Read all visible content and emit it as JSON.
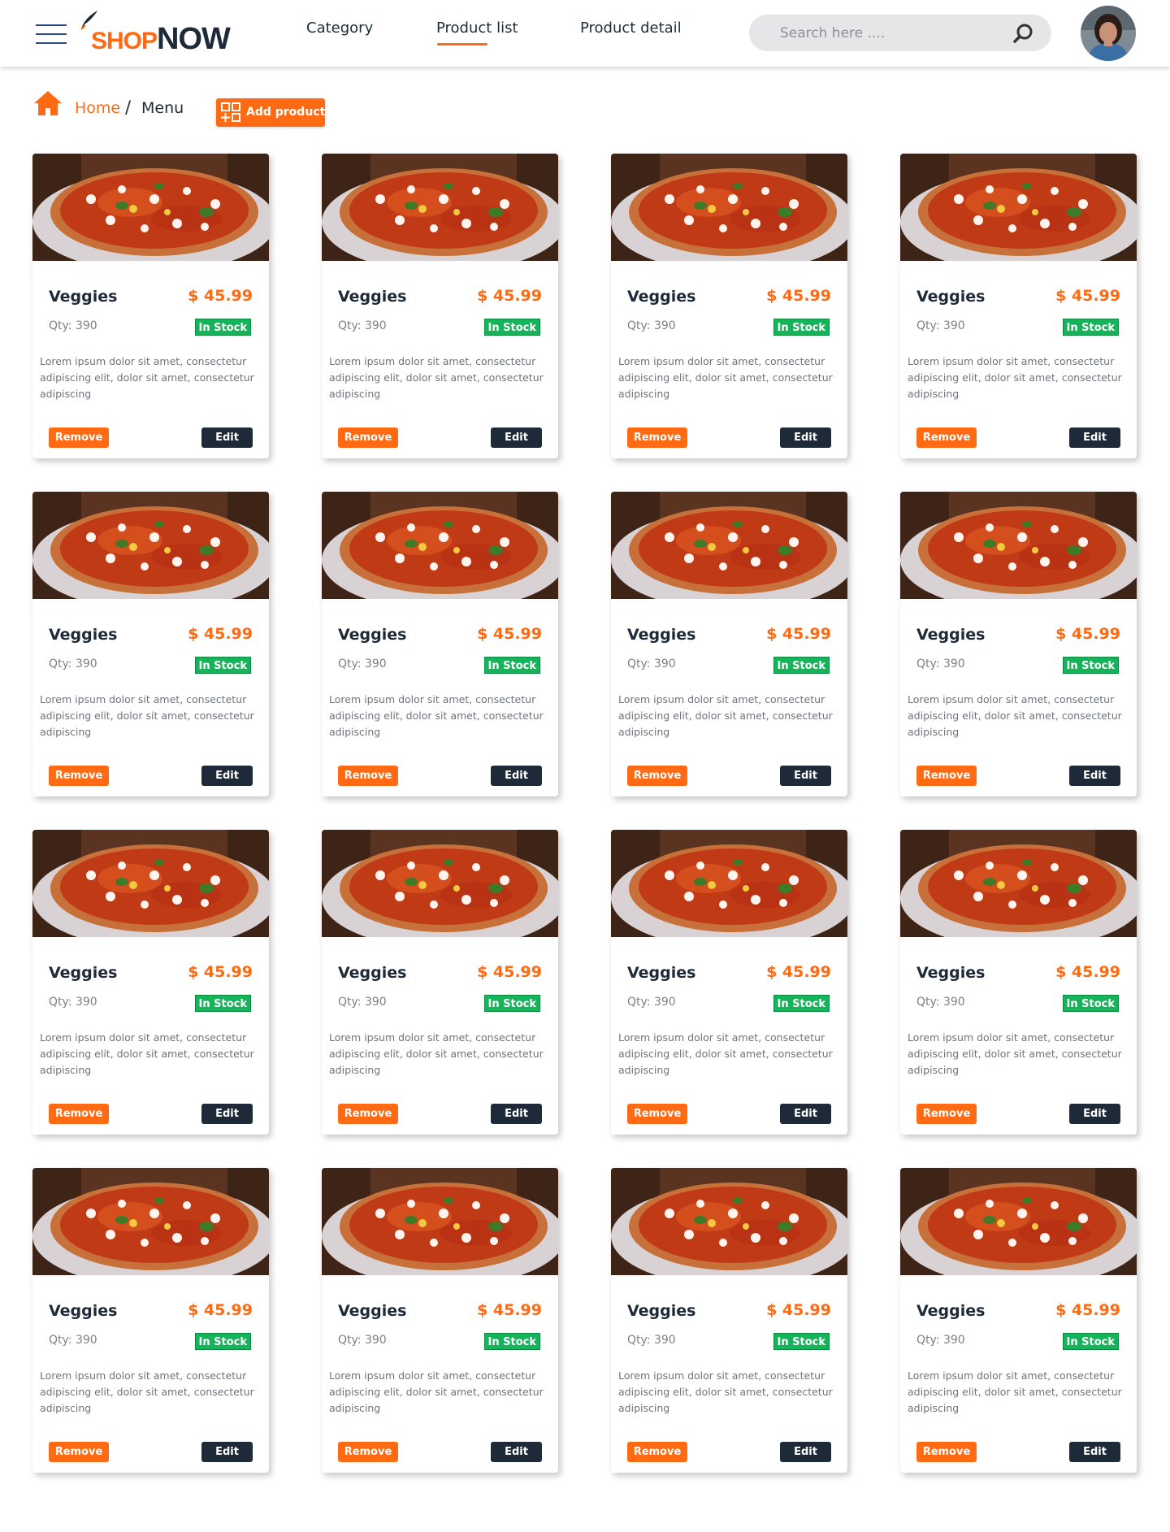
{
  "header": {
    "logo": {
      "shop": "SHOP",
      "now": "NOW"
    },
    "nav": [
      {
        "label": "Category",
        "active": false
      },
      {
        "label": "Product list",
        "active": true
      },
      {
        "label": "Product detail",
        "active": false
      }
    ],
    "search": {
      "placeholder": "Search here ...."
    }
  },
  "breadcrumb": {
    "home": "Home",
    "separator": "/",
    "current": "Menu"
  },
  "add_product_label": "Add product",
  "products": [
    {
      "name": "Veggies",
      "price": "$ 45.99",
      "qty": "Qty: 390",
      "stock": "In Stock",
      "description": "Lorem ipsum dolor sit amet, consectetur adipiscing elit, dolor sit amet, consectetur adipiscing",
      "remove": "Remove",
      "edit": "Edit"
    },
    {
      "name": "Veggies",
      "price": "$ 45.99",
      "qty": "Qty: 390",
      "stock": "In Stock",
      "description": "Lorem ipsum dolor sit amet, consectetur adipiscing elit, dolor sit amet, consectetur adipiscing",
      "remove": "Remove",
      "edit": "Edit"
    },
    {
      "name": "Veggies",
      "price": "$ 45.99",
      "qty": "Qty: 390",
      "stock": "In Stock",
      "description": "Lorem ipsum dolor sit amet, consectetur adipiscing elit, dolor sit amet, consectetur adipiscing",
      "remove": "Remove",
      "edit": "Edit"
    },
    {
      "name": "Veggies",
      "price": "$ 45.99",
      "qty": "Qty: 390",
      "stock": "In Stock",
      "description": "Lorem ipsum dolor sit amet, consectetur adipiscing elit, dolor sit amet, consectetur adipiscing",
      "remove": "Remove",
      "edit": "Edit"
    },
    {
      "name": "Veggies",
      "price": "$ 45.99",
      "qty": "Qty: 390",
      "stock": "In Stock",
      "description": "Lorem ipsum dolor sit amet, consectetur adipiscing elit, dolor sit amet, consectetur adipiscing",
      "remove": "Remove",
      "edit": "Edit"
    },
    {
      "name": "Veggies",
      "price": "$ 45.99",
      "qty": "Qty: 390",
      "stock": "In Stock",
      "description": "Lorem ipsum dolor sit amet, consectetur adipiscing elit, dolor sit amet, consectetur adipiscing",
      "remove": "Remove",
      "edit": "Edit"
    },
    {
      "name": "Veggies",
      "price": "$ 45.99",
      "qty": "Qty: 390",
      "stock": "In Stock",
      "description": "Lorem ipsum dolor sit amet, consectetur adipiscing elit, dolor sit amet, consectetur adipiscing",
      "remove": "Remove",
      "edit": "Edit"
    },
    {
      "name": "Veggies",
      "price": "$ 45.99",
      "qty": "Qty: 390",
      "stock": "In Stock",
      "description": "Lorem ipsum dolor sit amet, consectetur adipiscing elit, dolor sit amet, consectetur adipiscing",
      "remove": "Remove",
      "edit": "Edit"
    },
    {
      "name": "Veggies",
      "price": "$ 45.99",
      "qty": "Qty: 390",
      "stock": "In Stock",
      "description": "Lorem ipsum dolor sit amet, consectetur adipiscing elit, dolor sit amet, consectetur adipiscing",
      "remove": "Remove",
      "edit": "Edit"
    },
    {
      "name": "Veggies",
      "price": "$ 45.99",
      "qty": "Qty: 390",
      "stock": "In Stock",
      "description": "Lorem ipsum dolor sit amet, consectetur adipiscing elit, dolor sit amet, consectetur adipiscing",
      "remove": "Remove",
      "edit": "Edit"
    },
    {
      "name": "Veggies",
      "price": "$ 45.99",
      "qty": "Qty: 390",
      "stock": "In Stock",
      "description": "Lorem ipsum dolor sit amet, consectetur adipiscing elit, dolor sit amet, consectetur adipiscing",
      "remove": "Remove",
      "edit": "Edit"
    },
    {
      "name": "Veggies",
      "price": "$ 45.99",
      "qty": "Qty: 390",
      "stock": "In Stock",
      "description": "Lorem ipsum dolor sit amet, consectetur adipiscing elit, dolor sit amet, consectetur adipiscing",
      "remove": "Remove",
      "edit": "Edit"
    },
    {
      "name": "Veggies",
      "price": "$ 45.99",
      "qty": "Qty: 390",
      "stock": "In Stock",
      "description": "Lorem ipsum dolor sit amet, consectetur adipiscing elit, dolor sit amet, consectetur adipiscing",
      "remove": "Remove",
      "edit": "Edit"
    },
    {
      "name": "Veggies",
      "price": "$ 45.99",
      "qty": "Qty: 390",
      "stock": "In Stock",
      "description": "Lorem ipsum dolor sit amet, consectetur adipiscing elit, dolor sit amet, consectetur adipiscing",
      "remove": "Remove",
      "edit": "Edit"
    },
    {
      "name": "Veggies",
      "price": "$ 45.99",
      "qty": "Qty: 390",
      "stock": "In Stock",
      "description": "Lorem ipsum dolor sit amet, consectetur adipiscing elit, dolor sit amet, consectetur adipiscing",
      "remove": "Remove",
      "edit": "Edit"
    },
    {
      "name": "Veggies",
      "price": "$ 45.99",
      "qty": "Qty: 390",
      "stock": "In Stock",
      "description": "Lorem ipsum dolor sit amet, consectetur adipiscing elit, dolor sit amet, consectetur adipiscing",
      "remove": "Remove",
      "edit": "Edit"
    }
  ],
  "colors": {
    "accent": "#ff6a13",
    "dark": "#1e2a38",
    "stock_green": "#16b45a",
    "nav_icon": "#2b4a8c"
  },
  "icons": {
    "menu": "hamburger-icon",
    "search": "search-icon",
    "home": "home-icon",
    "add": "add-grid-icon",
    "product_image": "pizza-image"
  }
}
